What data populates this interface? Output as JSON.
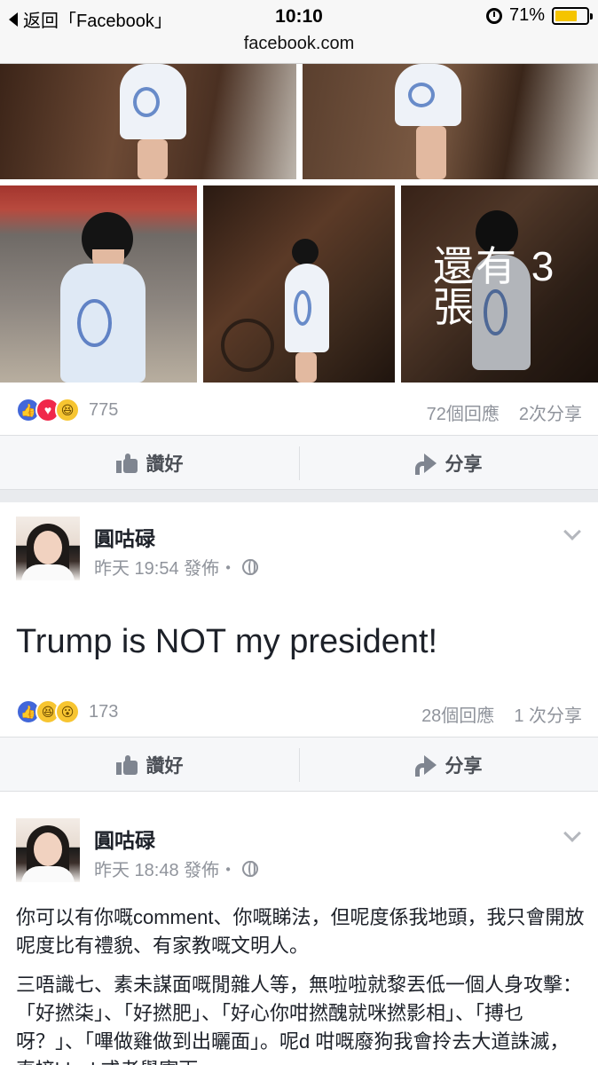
{
  "status_bar": {
    "back_label": "返回「Facebook」",
    "time": "10:10",
    "battery_percent": "71%",
    "battery_level": 0.71
  },
  "url_bar": {
    "url": "facebook.com"
  },
  "photo_post": {
    "more_photos_label": "還有 3 張",
    "reaction_icons": [
      "like",
      "love",
      "haha"
    ],
    "reaction_count": "775",
    "comments": "72個回應",
    "shares": "2次分享",
    "like_label": "讚好",
    "share_label": "分享"
  },
  "post1": {
    "author": "圓咕碌",
    "time": "昨天 19:54 發佈・",
    "text": "Trump is NOT my president!",
    "reaction_icons": [
      "like",
      "haha",
      "wow"
    ],
    "reaction_count": "173",
    "comments": "28個回應",
    "shares": "1 次分享",
    "like_label": "讚好",
    "share_label": "分享"
  },
  "post2": {
    "author": "圓咕碌",
    "time": "昨天 18:48 發佈・",
    "paragraph1": "你可以有你嘅comment、你嘅睇法，但呢度係我地頭，我只會開放呢度比有禮貌、有家教嘅文明人。",
    "paragraph2": "三唔識七、素未謀面嘅閒雜人等，無啦啦就黎丟低一個人身攻擊：「好撚柒」、「好撚肥」、「好心你咁撚醜就咪撚影相」、「搏乜呀？」、「嗶做雞做到出曬面」。呢d 咁嘅廢狗我會拎去大道誅滅，直接block或者舉寄兩"
  },
  "colors": {
    "facebook_blue": "#4267d9",
    "battery": "#f5c400"
  }
}
